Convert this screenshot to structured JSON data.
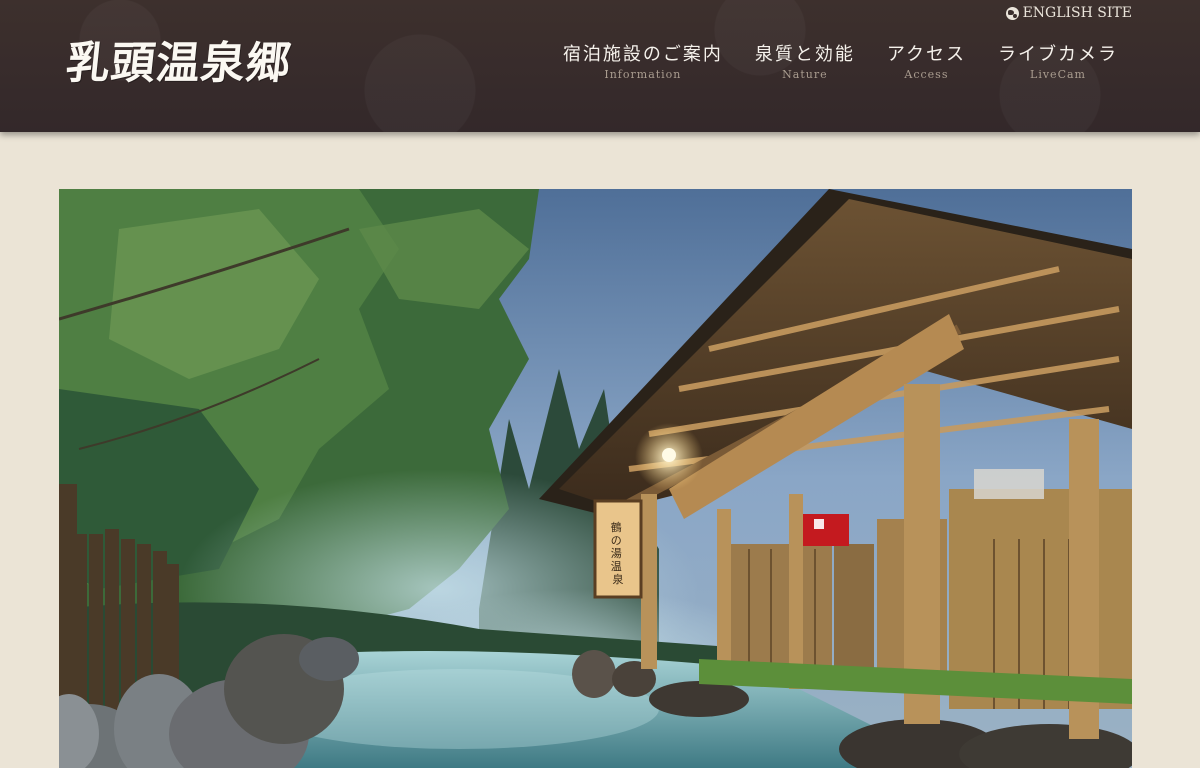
{
  "header": {
    "logo_text": "乳頭温泉郷",
    "english_link": "ENGLISH SITE",
    "nav": [
      {
        "ja": "宿泊施設のご案内",
        "en": "Information"
      },
      {
        "ja": "泉質と効能",
        "en": "Nature"
      },
      {
        "ja": "アクセス",
        "en": "Access"
      },
      {
        "ja": "ライブカメラ",
        "en": "LiveCam"
      }
    ]
  },
  "hero": {
    "lantern_text": "鶴の湯温泉",
    "colors": {
      "sky": "#7f9cbf",
      "forest": "#2f5a3a",
      "water": "#7fb9c4",
      "wood": "#b08b56",
      "curtain": "#c41a1f"
    }
  },
  "colors": {
    "header_bg": "#3a2e2c",
    "page_bg": "#ebe4d6",
    "nav_text": "#f6f2ec",
    "nav_sub": "#a99c8f"
  }
}
